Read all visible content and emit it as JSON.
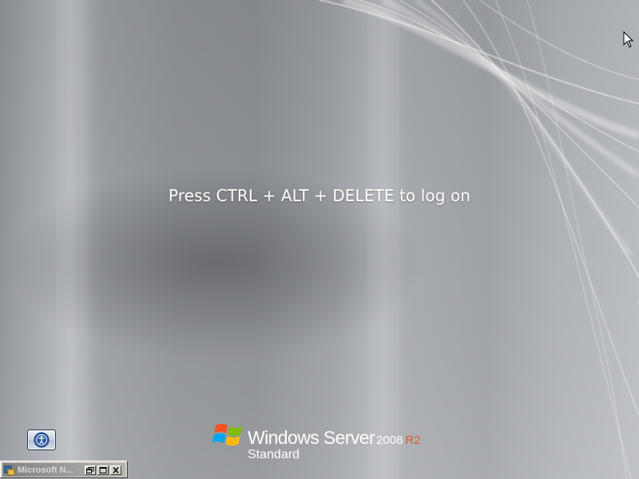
{
  "logon": {
    "prompt": "Press CTRL + ALT + DELETE to log on"
  },
  "branding": {
    "product": "Windows Server",
    "version": "2008",
    "release": "R2",
    "edition": "Standard",
    "logo_icon": "windows-flag-icon",
    "accent_color": "#e3592a"
  },
  "accessibility": {
    "icon": "ease-of-access-icon"
  },
  "minimized_window": {
    "title": "Microsoft N...",
    "icon": "app-icon",
    "buttons": [
      "restore-icon",
      "maximize-icon",
      "close-icon"
    ]
  },
  "cursor": {
    "icon": "arrow-cursor-icon"
  }
}
